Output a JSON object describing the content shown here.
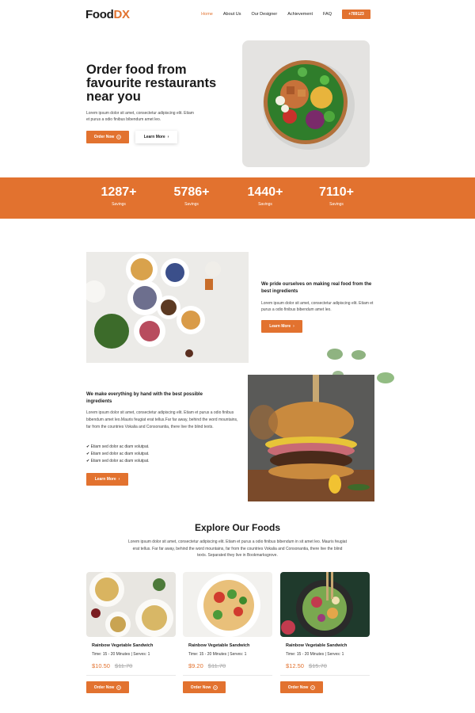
{
  "brand": {
    "part1": "Food",
    "part2": "DX",
    "accent": "#e2722f"
  },
  "nav": {
    "items": [
      "Home",
      "About Us",
      "Our Designer",
      "Achievement",
      "FAQ"
    ],
    "phone": "+789123"
  },
  "hero": {
    "title": "Order food from favourite restaurants near you",
    "text": "Lorem ipsum dolor sit amet, consectetur adipiscing elit. Etiam et purus a odio finibus bibendum amet leo.",
    "order_label": "Order Now",
    "learn_label": "Learn More"
  },
  "stats": [
    {
      "value": "1287+",
      "label": "Savings"
    },
    {
      "value": "5786+",
      "label": "Savings"
    },
    {
      "value": "1440+",
      "label": "Savings"
    },
    {
      "value": "7110+",
      "label": "Savings"
    }
  ],
  "feature1": {
    "title": "We pride ourselves on making real food from the best ingredients",
    "text": "Lorem ipsum dolor sit amet, consectetur adipiscing elit. Etiam et purus a odio finibus bibendum amet leo.",
    "button": "Learn More"
  },
  "feature2": {
    "title": "We make everything by hand with the best possible ingredients",
    "text": "Lorem ipsum dolor sit amet, consectetur adipiscing elit. Etiam et purus a odio finibus bibendum amet leo.Mauris feugiat erat tellus.Far far away, behind the word mountains, far from the countries Vokalia and Consonantia, there live the blind texts.",
    "list": [
      "Etiam sed dolor ac diam volutpat.",
      "Etiam sed dolor ac diam volutpat.",
      "Etiam sed dolor ac diam volutpat."
    ],
    "button": "Learn More"
  },
  "explore": {
    "title": "Explore Our Foods",
    "text": "Lorem ipsum dolor sit amet, consectetur adipiscing elit. Etiam et purus a odio finibus bibendum in sit amet leo. Mauris feugiat erat tellus. Far far away, behind the word mountains, far from the countries Vokalia and Consonantia, there live the blind texts. Separated they live in Bookmarksgrove.",
    "cards": [
      {
        "name": "Rainbow Vegetable Sandwich",
        "meta": "Time: 15 - 20 Minutes | Serves: 1",
        "price": "$10.50",
        "old_price": "$11.70",
        "button": "Order Now"
      },
      {
        "name": "Rainbow Vegetable Sandwich",
        "meta": "Time: 15 - 20 Minutes | Serves: 1",
        "price": "$9.20",
        "old_price": "$11.70",
        "button": "Order Now"
      },
      {
        "name": "Rainbow Vegetable Sandwich",
        "meta": "Time: 15 - 20 Minutes | Serves: 1",
        "price": "$12.50",
        "old_price": "$15.70",
        "button": "Order Now"
      }
    ]
  }
}
